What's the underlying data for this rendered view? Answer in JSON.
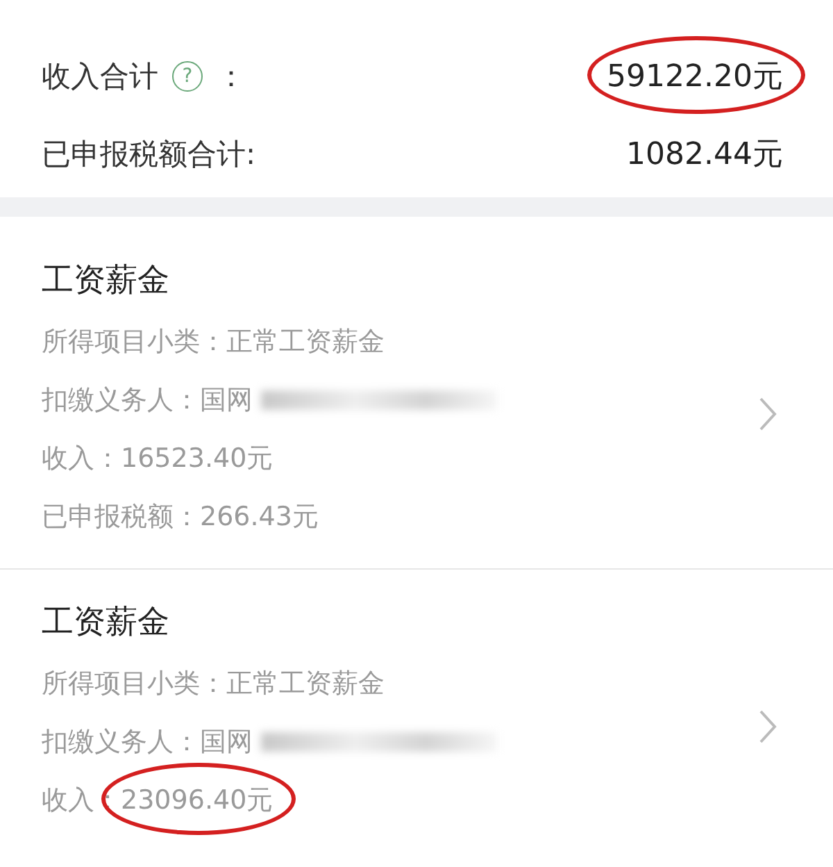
{
  "summary": [
    {
      "label": "收入合计",
      "help": "?",
      "separator": "：",
      "value": "59122.20元",
      "circled": true
    },
    {
      "label": "已申报税额合计:",
      "value": "1082.44元",
      "circled": false
    }
  ],
  "records": [
    {
      "title": "工资薪金",
      "fields": [
        {
          "label": "所得项目小类：",
          "value": "正常工资薪金",
          "redacted": false,
          "circled": false
        },
        {
          "label": "扣缴义务人：",
          "value": "国网",
          "redacted": true,
          "circled": false
        },
        {
          "label": "收入：",
          "value": "16523.40元",
          "redacted": false,
          "circled": false
        },
        {
          "label": "已申报税额：",
          "value": "266.43元",
          "redacted": false,
          "circled": false
        }
      ]
    },
    {
      "title": "工资薪金",
      "fields": [
        {
          "label": "所得项目小类：",
          "value": "正常工资薪金",
          "redacted": false,
          "circled": false
        },
        {
          "label": "扣缴义务人：",
          "value": "国网",
          "redacted": true,
          "circled": false
        },
        {
          "label": "收入：",
          "value": "23096.40元",
          "redacted": false,
          "circled": true
        }
      ]
    }
  ]
}
